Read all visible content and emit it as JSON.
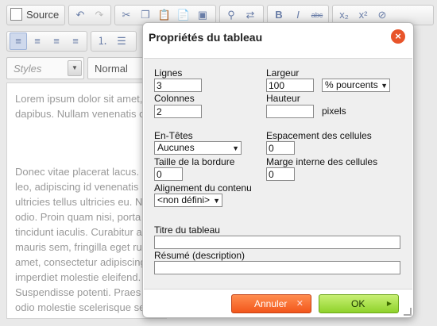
{
  "toolbar": {
    "source_label": "Source",
    "styles_placeholder": "Styles",
    "format_value": "Normal",
    "icons": [
      "undo-icon",
      "redo-icon",
      "cut-icon",
      "copy-icon",
      "paste-icon",
      "paste-word-icon",
      "select-all-icon",
      "find-icon",
      "replace-icon",
      "bold-icon",
      "italic-icon",
      "strikethrough-icon",
      "subscript-icon",
      "superscript-icon",
      "remove-format-icon",
      "align-left-icon",
      "align-center-icon",
      "align-right-icon",
      "justify-icon",
      "numbered-list-icon",
      "bullet-list-icon"
    ]
  },
  "content": {
    "paragraph1_line1": "Lorem ipsum dolor sit amet,",
    "paragraph1_line2": "dapibus. Nullam venenatis c",
    "paragraph2": [
      "Donec vitae placerat lacus.",
      "leo, adipiscing id venenatis",
      "ultricies tellus ultricies eu. N",
      "odio. Proin quam nisi, porta",
      "tincidunt iaculis. Curabitur a",
      "mauris sem, fringilla eget ru",
      "amet, consectetur adipiscing",
      "imperdiet molestie eleifend.",
      "Suspendisse potenti. Praes",
      "odio molestie scelerisque se"
    ]
  },
  "dialog": {
    "title": "Propriétés du tableau",
    "rows_label": "Lignes",
    "rows_value": "3",
    "cols_label": "Colonnes",
    "cols_value": "2",
    "width_label": "Largeur",
    "width_value": "100",
    "width_unit": "% pourcents",
    "height_label": "Hauteur",
    "height_value": "",
    "height_unit": "pixels",
    "headers_label": "En-Têtes",
    "headers_value": "Aucunes",
    "border_label": "Taille de la bordure",
    "border_value": "0",
    "align_label": "Alignement du contenu",
    "align_value": "<non défini>",
    "spacing_label": "Espacement des cellules",
    "spacing_value": "0",
    "padding_label": "Marge interne des cellules",
    "padding_value": "0",
    "caption_label": "Titre du tableau",
    "caption_value": "",
    "summary_label": "Résumé (description)",
    "summary_value": "",
    "cancel_label": "Annuler",
    "ok_label": "OK"
  },
  "colors": {
    "cancel": "#f2561b",
    "ok": "#8fd22b",
    "close": "#e8542a"
  }
}
